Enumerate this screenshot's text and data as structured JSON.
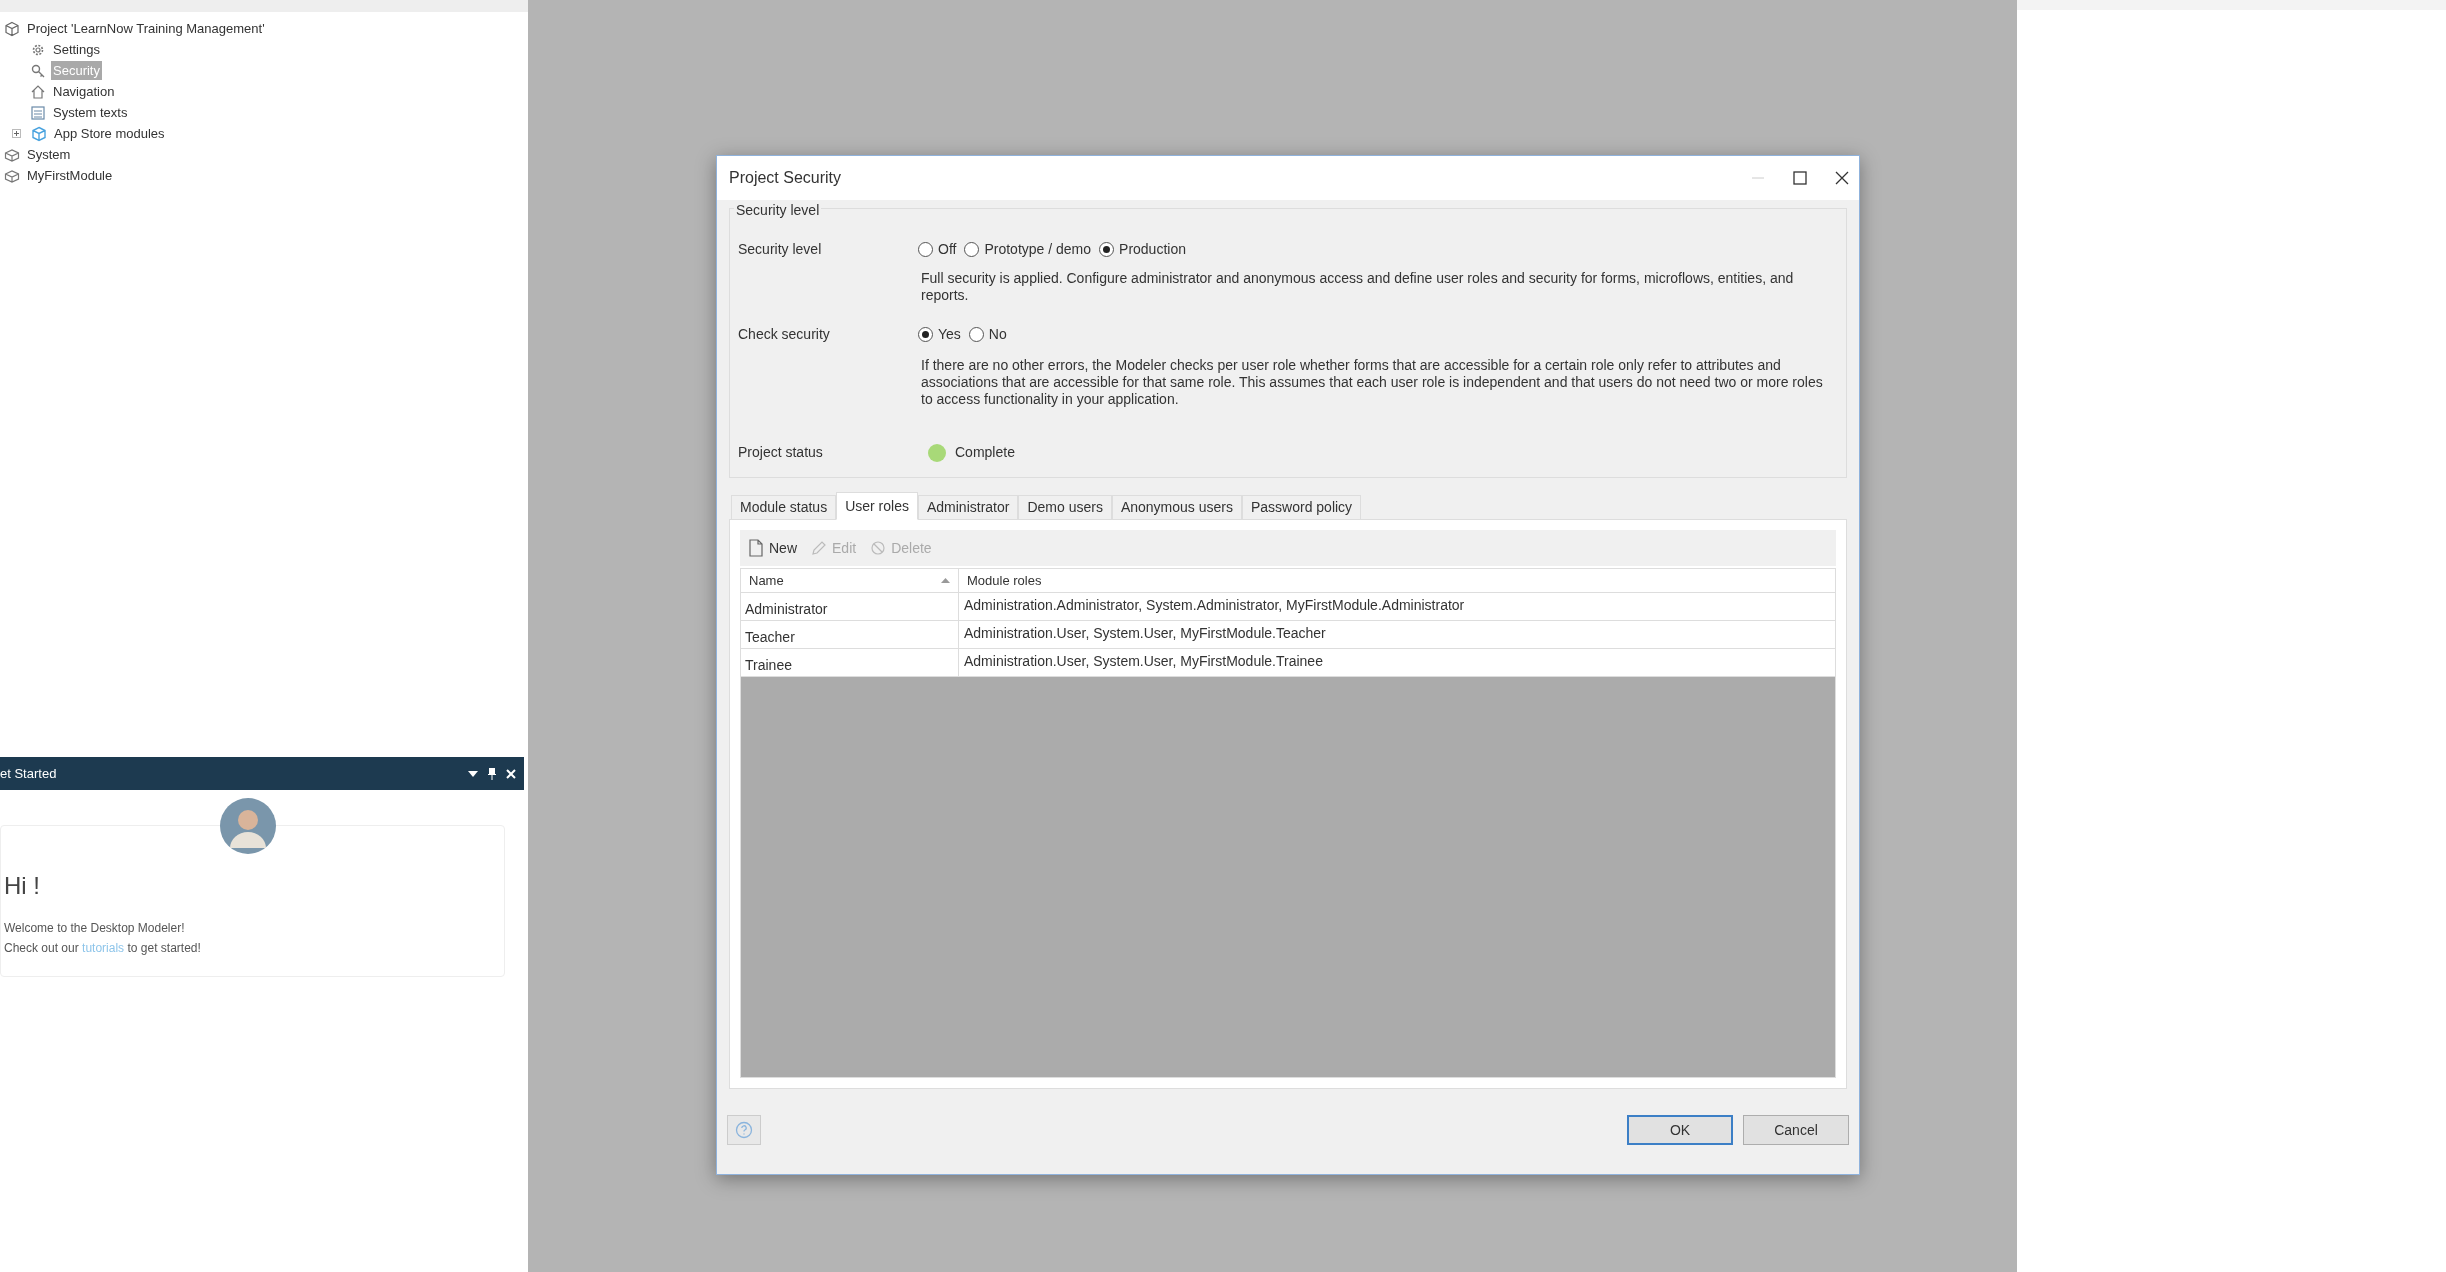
{
  "explorer": {
    "items": [
      {
        "label": "Project 'LearnNow Training Management'",
        "kind": "project",
        "selected": false,
        "collapsed": false,
        "children": [
          {
            "label": "Settings",
            "kind": "settings",
            "selected": false,
            "collapsed": false
          },
          {
            "label": "Security",
            "kind": "security",
            "selected": true,
            "collapsed": false
          },
          {
            "label": "Navigation",
            "kind": "navigation",
            "selected": false,
            "collapsed": false
          },
          {
            "label": "System texts",
            "kind": "texts",
            "selected": false,
            "collapsed": false
          },
          {
            "label": "App Store modules",
            "kind": "appstore",
            "selected": false,
            "collapsed": true
          }
        ]
      },
      {
        "label": "System",
        "kind": "module",
        "selected": false,
        "collapsed": false
      },
      {
        "label": "MyFirstModule",
        "kind": "module",
        "selected": false,
        "collapsed": false
      }
    ]
  },
  "get_started": {
    "title": "et Started",
    "greeting": "Hi !",
    "line_1": "Welcome to the Desktop Modeler!",
    "line_2_before": "Check out our",
    "link": "tutorials",
    "line_2_after": "to get started!"
  },
  "dialog": {
    "title": "Project Security",
    "group_title": "Security level",
    "security_level": {
      "label": "Security level",
      "options": [
        {
          "label": "Off",
          "selected": false
        },
        {
          "label": "Prototype / demo",
          "selected": false
        },
        {
          "label": "Production",
          "selected": true
        }
      ],
      "description": "Full security is applied. Configure administrator and anonymous access and define user roles and security for forms, microflows, entities, and reports."
    },
    "check_security": {
      "label": "Check security",
      "options": [
        {
          "label": "Yes",
          "selected": true
        },
        {
          "label": "No",
          "selected": false
        }
      ],
      "description": "If there are no other errors, the Modeler checks per user role whether forms that are accessible for a certain role only refer to attributes and associations that are accessible for that same role. This assumes that each user role is independent and that users do not need two or more roles to access functionality in your application."
    },
    "project_status": {
      "label": "Project status",
      "value": "Complete",
      "color": "#a8d978"
    },
    "tabs": [
      {
        "label": "Module status",
        "selected": false
      },
      {
        "label": "User roles",
        "selected": true
      },
      {
        "label": "Administrator",
        "selected": false
      },
      {
        "label": "Demo users",
        "selected": false
      },
      {
        "label": "Anonymous users",
        "selected": false
      },
      {
        "label": "Password policy",
        "selected": false
      }
    ],
    "toolbar": [
      {
        "label": "New",
        "kind": "new",
        "disabled": false
      },
      {
        "label": "Edit",
        "kind": "edit",
        "disabled": true
      },
      {
        "label": "Delete",
        "kind": "delete",
        "disabled": true
      }
    ],
    "table": {
      "columns": [
        {
          "label": "Name",
          "sorted": true
        },
        {
          "label": "Module roles",
          "sorted": false
        }
      ],
      "rows": [
        [
          "Administrator",
          "Administration.Administrator, System.Administrator, MyFirstModule.Administrator"
        ],
        [
          "Teacher",
          "Administration.User, System.User, MyFirstModule.Teacher"
        ],
        [
          "Trainee",
          "Administration.User, System.User, MyFirstModule.Trainee"
        ]
      ]
    },
    "buttons": [
      {
        "label": "OK",
        "default": true
      },
      {
        "label": "Cancel",
        "default": false
      }
    ]
  }
}
